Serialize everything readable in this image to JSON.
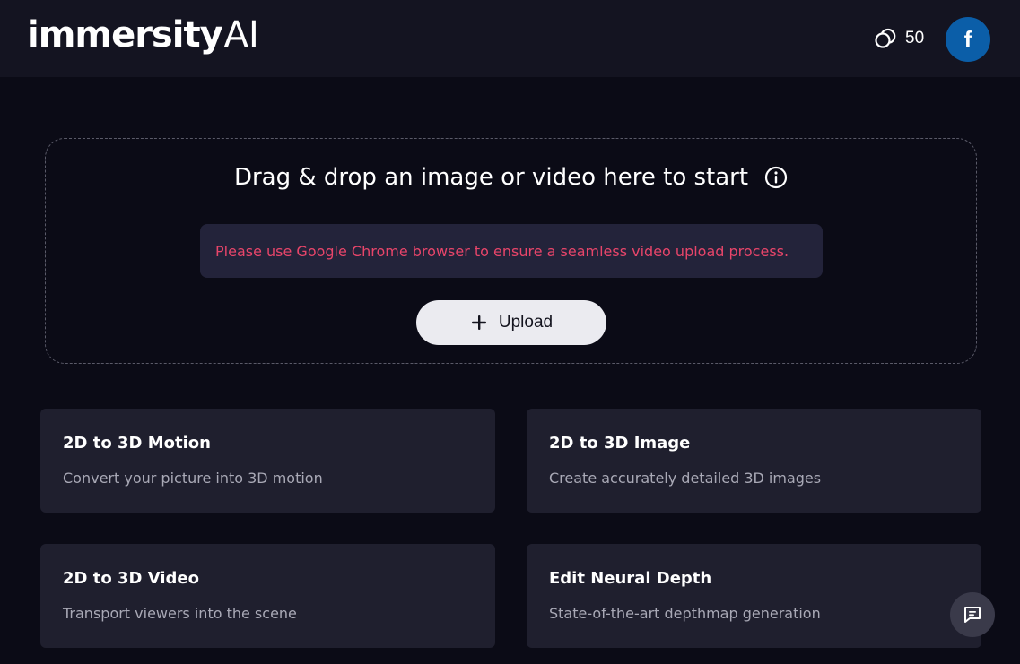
{
  "header": {
    "logo_main": "immersity",
    "logo_suffix": "AI",
    "credits_icon": "coins-icon",
    "credits_count": "50",
    "avatar_initial": "f",
    "avatar_color": "#0b5ea8"
  },
  "dropzone": {
    "title": "Drag & drop an image or video here to start",
    "info_icon": "info-icon",
    "notice": "Please use Google Chrome browser to ensure a seamless video upload process.",
    "notice_color": "#e8456a",
    "upload_icon": "plus-icon",
    "upload_label": "Upload"
  },
  "cards": [
    {
      "title": "2D to 3D Motion",
      "description": "Convert your picture into 3D motion"
    },
    {
      "title": "2D to 3D Image",
      "description": "Create accurately detailed 3D images"
    },
    {
      "title": "2D to 3D Video",
      "description": "Transport viewers into the scene"
    },
    {
      "title": "Edit Neural Depth",
      "description": "State-of-the-art depthmap generation"
    }
  ],
  "chat_widget": {
    "icon": "chat-icon"
  },
  "colors": {
    "background": "#0b0b16",
    "header_background": "#141421",
    "card_background": "#1f1f2e",
    "upload_button_background": "#ebebf0"
  }
}
